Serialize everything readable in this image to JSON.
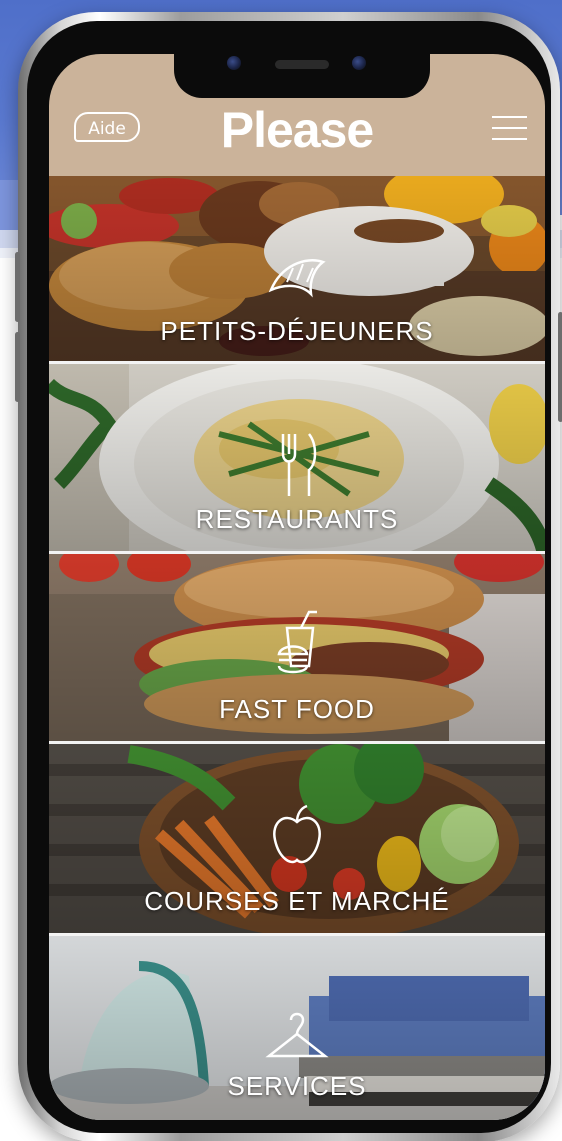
{
  "app": {
    "logo_text": "Please",
    "help_label": "Aide",
    "menu_icon": "hamburger-menu-icon"
  },
  "categories": [
    {
      "label": "PETITS-DÉJEUNERS",
      "icon": "croissant-icon",
      "photo": "breakfast-photo"
    },
    {
      "label": "RESTAURANTS",
      "icon": "fork-knife-icon",
      "photo": "pasta-plate-photo"
    },
    {
      "label": "FAST FOOD",
      "icon": "burger-drink-icon",
      "photo": "sandwich-photo"
    },
    {
      "label": "COURSES ET MARCHÉ",
      "icon": "apple-icon",
      "photo": "vegetable-basket-photo"
    },
    {
      "label": "SERVICES",
      "icon": "hanger-icon",
      "photo": "ironing-laundry-photo"
    }
  ],
  "colors": {
    "header_bg": "#cbb39a",
    "header_text": "#ffffff",
    "backdrop_blue": "#5a79d0"
  }
}
